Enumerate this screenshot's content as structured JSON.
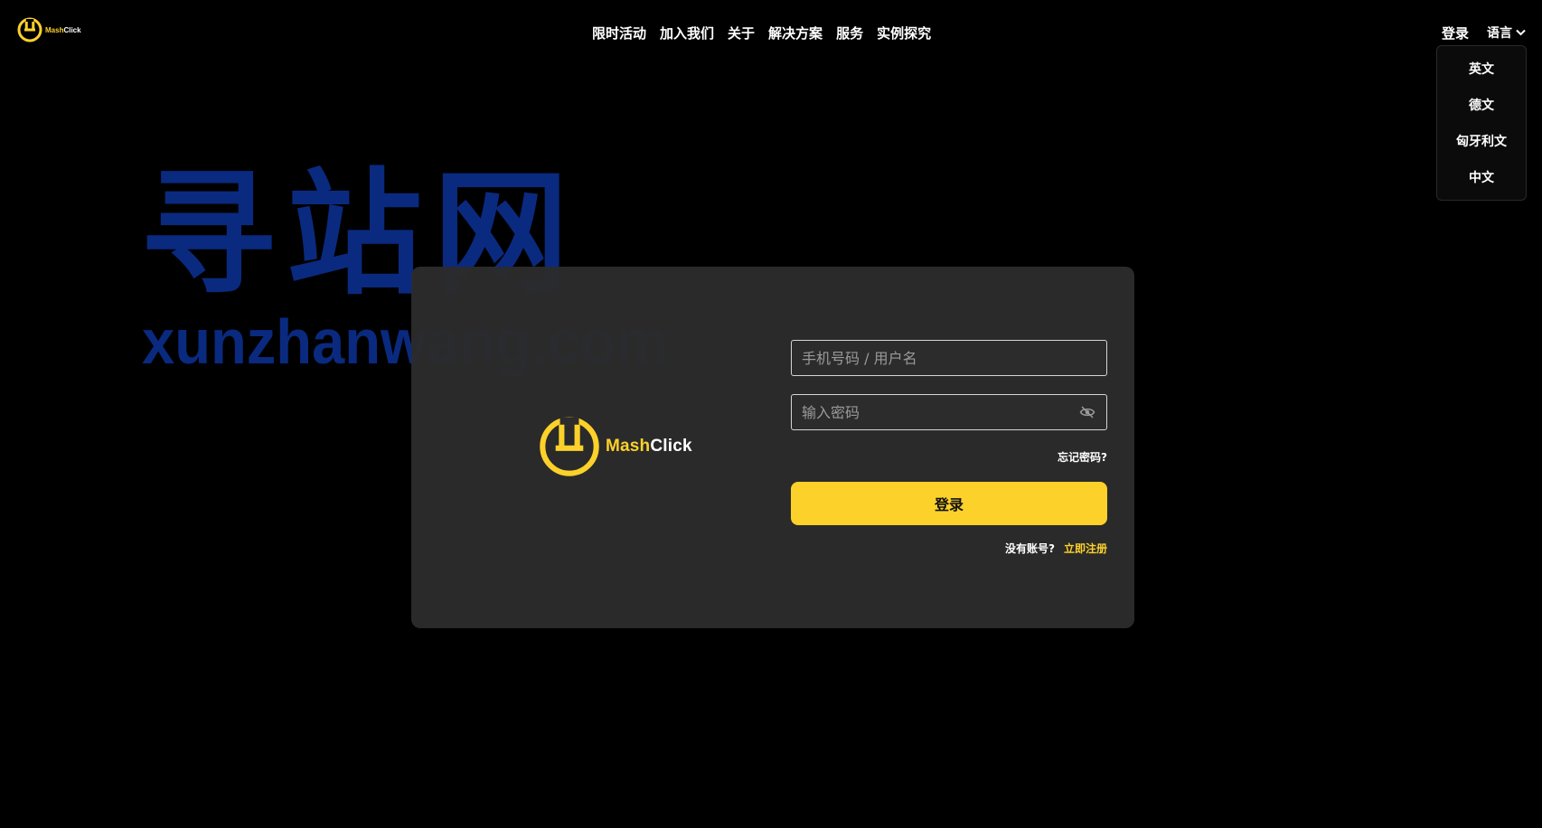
{
  "brand": {
    "name_part1": "Mash",
    "name_part2": "Click",
    "logo_icon": "power-icon"
  },
  "nav": {
    "items": [
      "限时活动",
      "加入我们",
      "关于",
      "解决方案",
      "服务",
      "实例探究"
    ]
  },
  "header": {
    "login_label": "登录",
    "language_label": "语言"
  },
  "language_menu": {
    "options": [
      "英文",
      "德文",
      "匈牙利文",
      "中文"
    ]
  },
  "watermark": {
    "cn": "寻站网",
    "en": "xunzhanwang.com"
  },
  "login_form": {
    "username_placeholder": "手机号码 / 用户名",
    "password_placeholder": "输入密码",
    "password_toggle_icon": "eye-off-icon",
    "forgot_label": "忘记密码?",
    "submit_label": "登录",
    "no_account_label": "没有账号?",
    "register_label": "立即注册"
  },
  "colors": {
    "accent": "#fcd12a",
    "background": "#000000",
    "card": "#2c2c2c",
    "watermark": "#0a2a80"
  }
}
